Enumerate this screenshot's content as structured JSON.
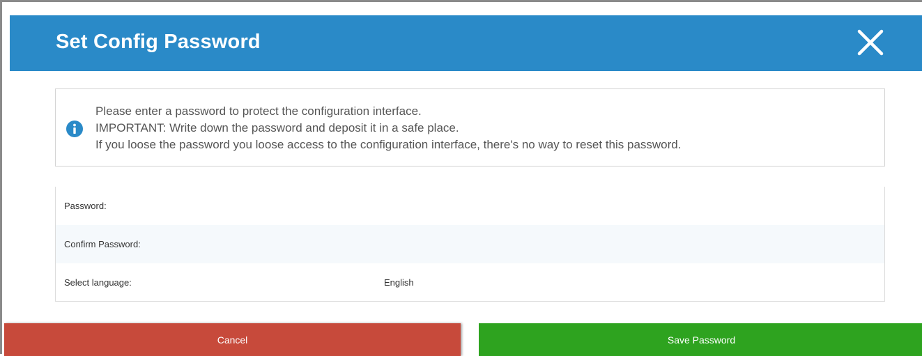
{
  "dialog": {
    "title": "Set Config Password",
    "close_icon": "close-icon"
  },
  "info": {
    "icon": "info-icon",
    "accent_color": "#2a8ac8",
    "lines": [
      "Please enter a password to protect the configuration interface.",
      "IMPORTANT: Write down the password and deposit it in a safe place.",
      "If you loose the password you loose access to the configuration interface, there's no way to reset this password."
    ]
  },
  "form": {
    "password_label": "Password:",
    "password_value": "",
    "confirm_label": "Confirm Password:",
    "confirm_value": "",
    "language_label": "Select language:",
    "language_value": "English"
  },
  "buttons": {
    "cancel_label": "Cancel",
    "cancel_color": "#c74a3b",
    "save_label": "Save Password",
    "save_color": "#2ea31f"
  }
}
